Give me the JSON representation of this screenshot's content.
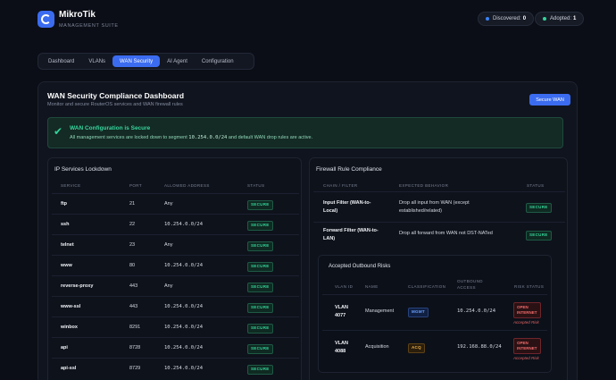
{
  "brand": {
    "name": "MikroTik",
    "subtitle": "MANAGEMENT SUITE"
  },
  "header": {
    "discovered": {
      "label": "Discovered:",
      "value": "0",
      "dot_color": "#3b82f6"
    },
    "adopted": {
      "label": "Adopted:",
      "value": "1",
      "dot_color": "#34d399"
    }
  },
  "tabs": [
    {
      "label": "Dashboard",
      "active": false
    },
    {
      "label": "VLANs",
      "active": false
    },
    {
      "label": "WAN Security",
      "active": true
    },
    {
      "label": "AI Agent",
      "active": false
    },
    {
      "label": "Configuration",
      "active": false
    }
  ],
  "page": {
    "title": "WAN Security Compliance Dashboard",
    "subtitle": "Monitor and secure RouterOS services and WAN firewall rules",
    "action_button": "Secure WAN"
  },
  "alert": {
    "title": "WAN Configuration is Secure",
    "text_prefix": "All management services are locked down to segment",
    "segment": "10.254.0.0/24",
    "text_suffix": "and default WAN drop rules are active."
  },
  "ip_services": {
    "title": "IP Services Lockdown",
    "columns": [
      "SERVICE",
      "PORT",
      "ALLOWED ADDRESS",
      "STATUS"
    ],
    "rows": [
      {
        "service": "ftp",
        "port": "21",
        "address": "Any",
        "status": "SECURE"
      },
      {
        "service": "ssh",
        "port": "22",
        "address": "10.254.0.0/24",
        "status": "SECURE"
      },
      {
        "service": "telnet",
        "port": "23",
        "address": "Any",
        "status": "SECURE"
      },
      {
        "service": "www",
        "port": "80",
        "address": "10.254.0.0/24",
        "status": "SECURE"
      },
      {
        "service": "reverse-proxy",
        "port": "443",
        "address": "Any",
        "status": "SECURE"
      },
      {
        "service": "www-ssl",
        "port": "443",
        "address": "10.254.0.0/24",
        "status": "SECURE"
      },
      {
        "service": "winbox",
        "port": "8291",
        "address": "10.254.0.0/24",
        "status": "SECURE"
      },
      {
        "service": "api",
        "port": "8728",
        "address": "10.254.0.0/24",
        "status": "SECURE"
      },
      {
        "service": "api-ssl",
        "port": "8729",
        "address": "10.254.0.0/24",
        "status": "SECURE"
      }
    ]
  },
  "firewall": {
    "title": "Firewall Rule Compliance",
    "columns": [
      "CHAIN / FILTER",
      "EXPECTED BEHAVIOR",
      "STATUS"
    ],
    "rows": [
      {
        "chain_line1": "Input Filter (WAN-to-",
        "chain_line2": "Local)",
        "behavior_line1": "Drop all input from WAN (except",
        "behavior_line2": "established/related)",
        "status": "SECURE"
      },
      {
        "chain_line1": "Forward Filter (WAN-to-",
        "chain_line2": "LAN)",
        "behavior_line1": "Drop all forward from WAN not DST-NATed",
        "behavior_line2": "",
        "status": "SECURE"
      }
    ]
  },
  "risks": {
    "title": "Accepted Outbound Risks",
    "columns": [
      "VLAN ID",
      "NAME",
      "CLASSIFICATION",
      "OUTBOUND",
      "ACCESS",
      "RISK STATUS"
    ],
    "rows": [
      {
        "vlan_line1": "VLAN",
        "vlan_line2": "4077",
        "name": "Management",
        "classification": "MGMT",
        "access": "10.254.0.0/24",
        "risk_line1": "OPEN",
        "risk_line2": "INTERNET",
        "note": "Accepted Risk"
      },
      {
        "vlan_line1": "VLAN",
        "vlan_line2": "4088",
        "name": "Acquisition",
        "classification": "ACQ",
        "access": "192.168.88.0/24",
        "risk_line1": "OPEN",
        "risk_line2": "INTERNET",
        "note": "Accepted Risk"
      }
    ]
  }
}
